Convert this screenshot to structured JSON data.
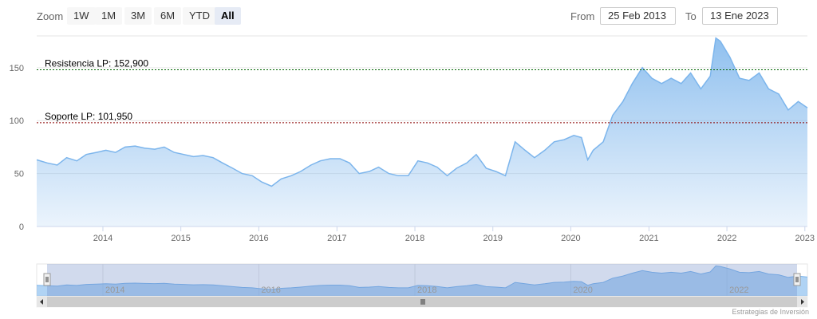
{
  "toolbar": {
    "zoom_label": "Zoom",
    "buttons": [
      {
        "label": "1W",
        "active": false
      },
      {
        "label": "1M",
        "active": false
      },
      {
        "label": "3M",
        "active": false
      },
      {
        "label": "6M",
        "active": false
      },
      {
        "label": "YTD",
        "active": false
      },
      {
        "label": "All",
        "active": true
      }
    ],
    "from_label": "From",
    "from_value": "25 Feb 2013",
    "to_label": "To",
    "to_value": "13 Ene 2023"
  },
  "credits": "Estrategias de Inversión",
  "colors": {
    "series_line": "#7cb5ec",
    "area_top": "#7cb5ec",
    "area_bottom": "#ffffff",
    "resistance_line": "#006400",
    "support_line": "#8b0000",
    "navigator_mask": "#6685c2"
  },
  "chart_data": {
    "type": "area",
    "xlim": [
      "2013-02-25",
      "2023-01-13"
    ],
    "ylim": [
      0,
      180
    ],
    "y_ticks": [
      0,
      50,
      100,
      150
    ],
    "x_ticks": [
      "2014",
      "2015",
      "2016",
      "2017",
      "2018",
      "2019",
      "2020",
      "2021",
      "2022",
      "2023"
    ],
    "navigator_ticks": [
      "2014",
      "2016",
      "2018",
      "2020",
      "2022"
    ],
    "plot_lines": [
      {
        "label": "Resistencia LP: 152,900",
        "value": 148,
        "color": "#006400"
      },
      {
        "label": "Soporte LP: 101,950",
        "value": 98,
        "color": "#8b0000"
      }
    ],
    "series": [
      {
        "x": [
          "2013-02-25",
          "2013-04-15",
          "2013-06-01",
          "2013-07-15",
          "2013-09-01",
          "2013-10-15",
          "2013-12-01",
          "2014-01-15",
          "2014-03-01",
          "2014-04-15",
          "2014-06-01",
          "2014-07-15",
          "2014-09-01",
          "2014-10-15",
          "2014-12-01",
          "2015-01-15",
          "2015-03-01",
          "2015-04-15",
          "2015-06-01",
          "2015-07-15",
          "2015-09-01",
          "2015-10-15",
          "2015-12-01",
          "2016-01-15",
          "2016-03-01",
          "2016-04-15",
          "2016-06-01",
          "2016-07-15",
          "2016-09-01",
          "2016-10-15",
          "2016-12-01",
          "2017-01-15",
          "2017-03-01",
          "2017-04-15",
          "2017-06-01",
          "2017-07-15",
          "2017-09-01",
          "2017-10-15",
          "2017-12-01",
          "2018-01-15",
          "2018-03-01",
          "2018-04-15",
          "2018-06-01",
          "2018-07-15",
          "2018-09-01",
          "2018-10-15",
          "2018-12-01",
          "2019-01-15",
          "2019-03-01",
          "2019-04-15",
          "2019-06-01",
          "2019-07-15",
          "2019-09-01",
          "2019-10-15",
          "2019-12-01",
          "2020-01-15",
          "2020-02-20",
          "2020-03-20",
          "2020-04-15",
          "2020-06-01",
          "2020-07-15",
          "2020-09-01",
          "2020-10-15",
          "2020-12-01",
          "2021-01-15",
          "2021-03-01",
          "2021-04-15",
          "2021-06-01",
          "2021-07-15",
          "2021-09-01",
          "2021-10-15",
          "2021-11-10",
          "2021-12-01",
          "2022-01-15",
          "2022-03-01",
          "2022-04-15",
          "2022-06-01",
          "2022-07-15",
          "2022-09-01",
          "2022-10-15",
          "2022-12-01",
          "2023-01-13"
        ],
        "values": [
          63,
          60,
          58,
          65,
          62,
          68,
          70,
          72,
          70,
          75,
          76,
          74,
          73,
          75,
          70,
          68,
          66,
          67,
          65,
          60,
          55,
          50,
          48,
          42,
          38,
          45,
          48,
          52,
          58,
          62,
          64,
          64,
          60,
          50,
          52,
          56,
          50,
          48,
          48,
          62,
          60,
          56,
          48,
          55,
          60,
          68,
          55,
          52,
          48,
          80,
          72,
          65,
          72,
          80,
          82,
          86,
          84,
          63,
          72,
          80,
          105,
          118,
          135,
          150,
          140,
          135,
          140,
          135,
          145,
          130,
          142,
          178,
          175,
          160,
          140,
          138,
          145,
          130,
          125,
          110,
          118,
          112
        ]
      }
    ]
  }
}
